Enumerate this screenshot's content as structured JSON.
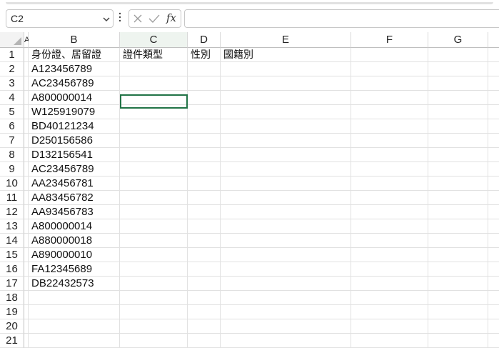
{
  "name_box": {
    "value": "C2"
  },
  "formula_bar": {
    "fx_label": "fx",
    "content": ""
  },
  "columns": [
    "A",
    "B",
    "C",
    "D",
    "E",
    "F",
    "G"
  ],
  "rows": [
    "1",
    "2",
    "3",
    "4",
    "5",
    "6",
    "7",
    "8",
    "9",
    "10",
    "11",
    "12",
    "13",
    "14",
    "15",
    "16",
    "17",
    "18",
    "19",
    "20",
    "21"
  ],
  "headers": {
    "B1": "身份證、居留證",
    "C1": "證件類型",
    "D1": "性別",
    "E1": "國籍別"
  },
  "ids": [
    "A123456789",
    "AC23456789",
    "A800000014",
    "W125919079",
    "BD40121234",
    "D250156586",
    "D132156541",
    "AC23456789",
    "AA23456781",
    "AA83456782",
    "AA93456783",
    "A800000014",
    "A880000018",
    "A890000010",
    "FA12345689",
    "DB22432573"
  ],
  "icons": {
    "name_box_dropdown": "chevron-down-icon",
    "more": "kebab-icon",
    "cancel": "close-icon",
    "enter": "check-icon"
  },
  "colors": {
    "active_cell_border": "#217346"
  }
}
